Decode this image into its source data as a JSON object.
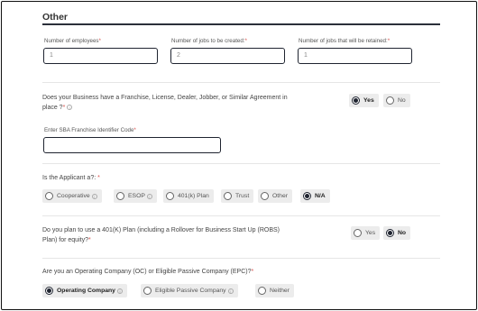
{
  "section": {
    "title": "Other"
  },
  "employment": {
    "employees": {
      "label": "Number of employees",
      "value": "1"
    },
    "jobs_created": {
      "label": "Number of jobs to be created:",
      "value": "2"
    },
    "jobs_retained": {
      "label": "Number of jobs that will be retained:",
      "value": "1"
    },
    "required_mark": "*"
  },
  "franchise": {
    "question_line1": "Does your Business have a Franchise, License, Dealer, Jobber, or Similar Agreement in",
    "question_line2": "place ?",
    "options": [
      "Yes",
      "No"
    ],
    "selected": "Yes",
    "code_label": "Enter SBA Franchise Identifier Code",
    "code_value": ""
  },
  "applicant": {
    "question": "Is the Applicant a?:",
    "options": [
      "Cooperative",
      "ESOP",
      "401(k) Plan",
      "Trust",
      "Other",
      "N/A"
    ],
    "selected": "N/A"
  },
  "plan401k": {
    "question_line1": "Do you plan to use a 401(K) Plan (including a Rollover for Business Start Up (ROBS)",
    "question_line2": "Plan) for equity?",
    "options": [
      "Yes",
      "No"
    ],
    "selected": "No"
  },
  "company_type": {
    "question": "Are you an Operating Company (OC) or Eligible Passive Company (EPC)?",
    "options": [
      "Operating Company",
      "Eligible Passive Company",
      "Neither"
    ],
    "selected": "Operating Company"
  },
  "icons": {
    "info": "info-icon",
    "radio": "radio-icon"
  },
  "colors": {
    "accent": "#1f2430",
    "required": "#d9534f",
    "option_bg": "#ececec"
  }
}
